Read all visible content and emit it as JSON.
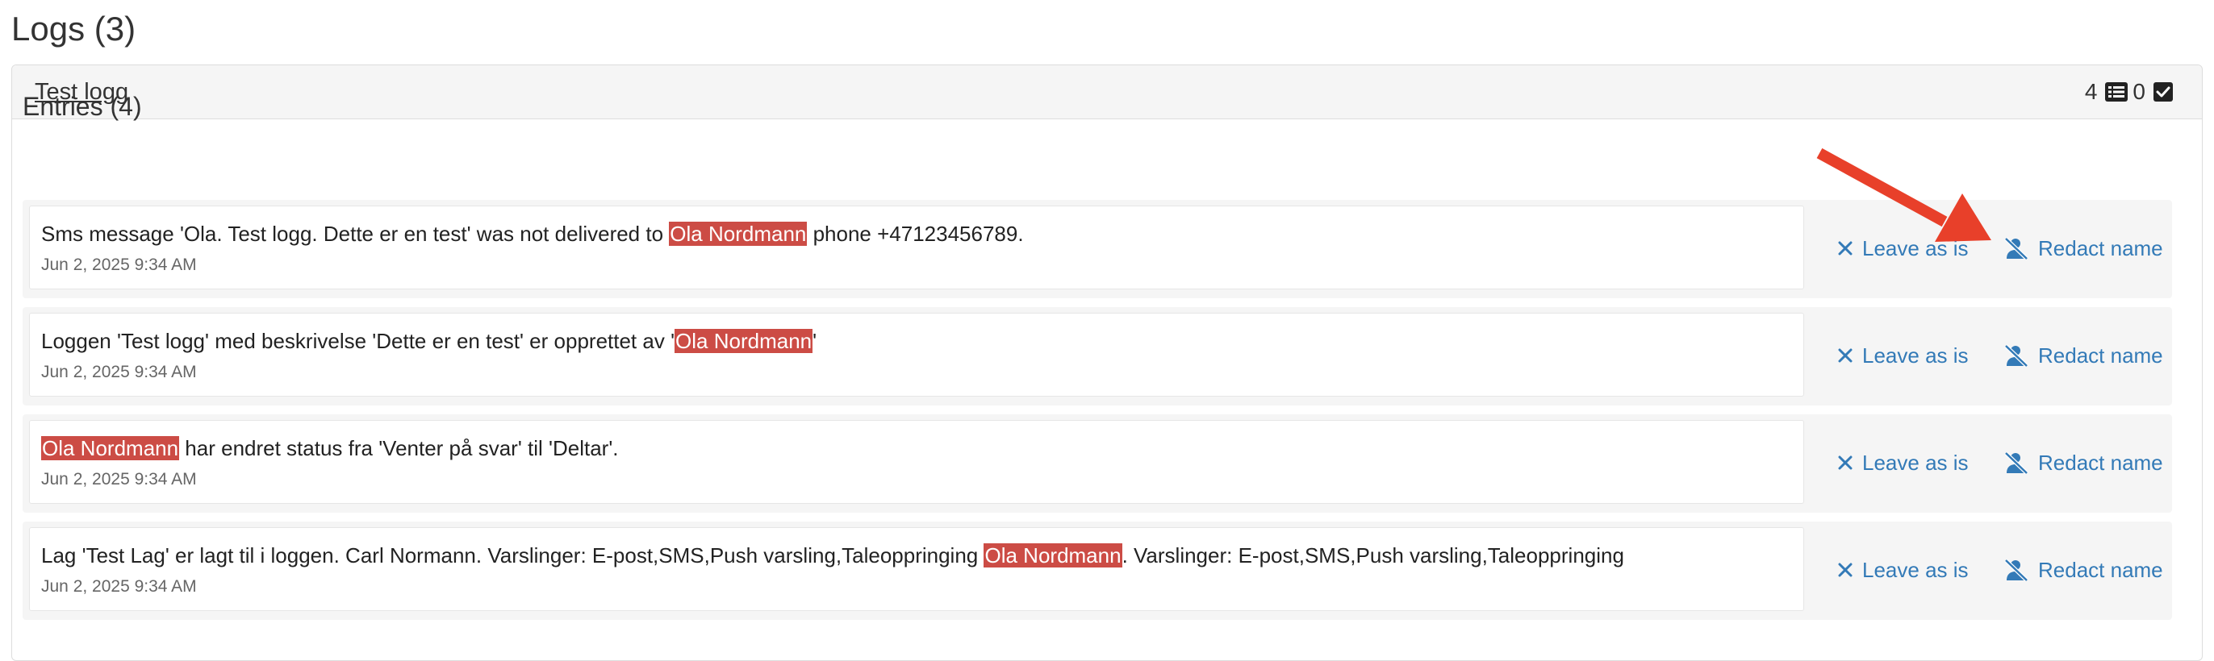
{
  "page": {
    "title": "Logs (3)"
  },
  "log": {
    "name": "Test logg",
    "entries_count": "4",
    "checked_count": "0",
    "list_icon": "list-icon",
    "check_icon": "check-square-icon"
  },
  "entries_title": "Entries (4)",
  "actions": {
    "leave_label": "Leave as is",
    "redact_label": "Redact name",
    "leave_icon": "close-icon",
    "redact_icon": "user-slash-icon"
  },
  "colors": {
    "highlight": "#cc4c45",
    "link": "#337ab7",
    "arrow": "#e8402a"
  },
  "entries": [
    {
      "pre": "Sms message 'Ola. Test logg. Dette er en test' was not delivered to ",
      "name": "Ola Nordmann",
      "post": " phone +47123456789.",
      "date": "Jun 2, 2025 9:34 AM"
    },
    {
      "pre": "Loggen 'Test logg' med beskrivelse 'Dette er en test' er opprettet av '",
      "name": "Ola Nordmann",
      "post": "'",
      "date": "Jun 2, 2025 9:34 AM"
    },
    {
      "pre": "",
      "name": "Ola Nordmann",
      "post": " har endret status fra 'Venter på svar' til 'Deltar'.",
      "date": "Jun 2, 2025 9:34 AM"
    },
    {
      "pre": "Lag 'Test Lag' er lagt til i loggen. Carl Normann. Varslinger: E-post,SMS,Push varsling,Taleoppringing ",
      "name": "Ola Nordmann",
      "post": ". Varslinger: E-post,SMS,Push varsling,Taleoppringing",
      "date": "Jun 2, 2025 9:34 AM"
    }
  ]
}
